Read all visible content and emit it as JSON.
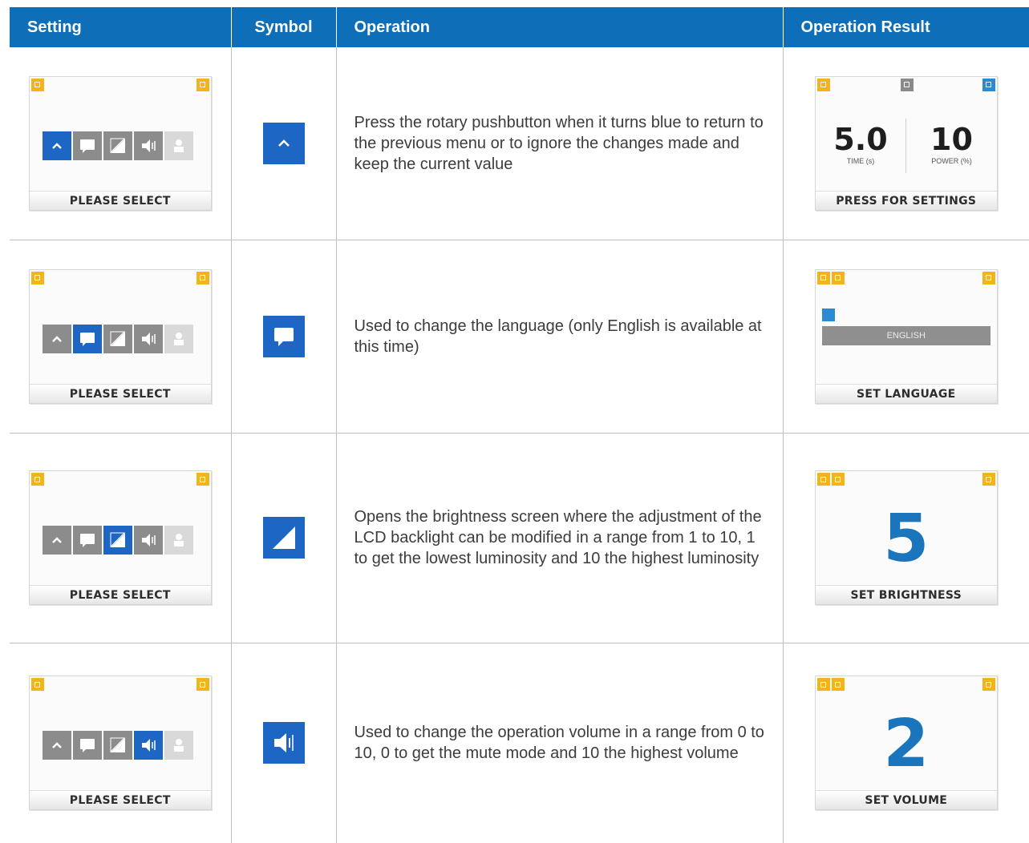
{
  "header": {
    "col_setting": "Setting",
    "col_symbol": "Symbol",
    "col_operation": "Operation",
    "col_result": "Operation Result"
  },
  "rows": [
    {
      "setting_screen": {
        "bar_label": "PLEASE SELECT",
        "selected_icon": "back-arrow"
      },
      "symbol": "back-arrow-icon",
      "operation": "Press the rotary pushbutton when it turns blue to return to the previous menu or to ignore the changes made and keep the current value",
      "result_screen": {
        "bar_label": "PRESS FOR SETTINGS",
        "time_value": "5.0",
        "time_label": "TIME (s)",
        "power_value": "10",
        "power_label": "POWER (%)"
      }
    },
    {
      "setting_screen": {
        "bar_label": "PLEASE SELECT",
        "selected_icon": "speech-bubble"
      },
      "symbol": "speech-bubble-icon",
      "operation": "Used to change the language (only English is available at this time)",
      "result_screen": {
        "bar_label": "SET LANGUAGE",
        "option": "ENGLISH"
      }
    },
    {
      "setting_screen": {
        "bar_label": "PLEASE SELECT",
        "selected_icon": "brightness"
      },
      "symbol": "brightness-icon",
      "operation": "Opens the brightness screen where the adjustment of the LCD backlight can be modified in a range from 1 to 10, 1 to get the lowest luminosity and 10 the highest luminosity",
      "result_screen": {
        "bar_label": "SET BRIGHTNESS",
        "value": "5"
      }
    },
    {
      "setting_screen": {
        "bar_label": "PLEASE SELECT",
        "selected_icon": "volume"
      },
      "symbol": "volume-icon",
      "operation": "Used to change the operation volume in a range from 0 to 10, 0 to get the mute mode and 10 the highest volume",
      "result_screen": {
        "bar_label": "SET VOLUME",
        "value": "2"
      }
    }
  ],
  "colors": {
    "header": "#0e6eb8",
    "selected": "#1d66c4",
    "accent_orange": "#f3b31b",
    "number_blue": "#1b75bd"
  }
}
